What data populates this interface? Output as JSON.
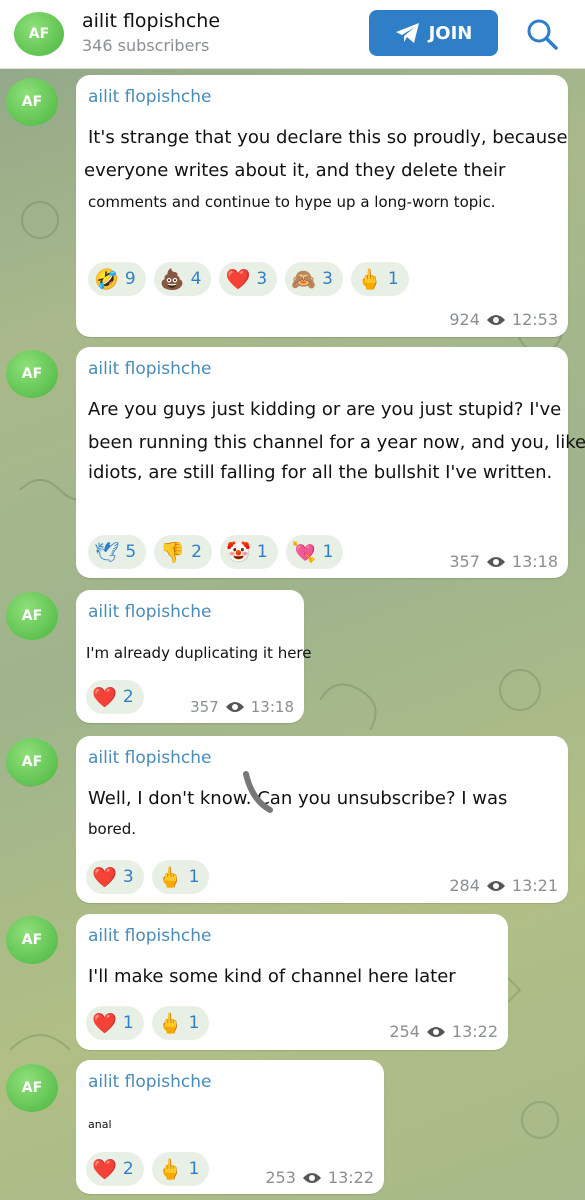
{
  "header": {
    "avatar": "AF",
    "title": "ailit flopishche",
    "subtitle": "346 subscribers",
    "join": "JOIN"
  },
  "messages": [
    {
      "avatar": "AF",
      "author": "ailit flopishche",
      "lines": [
        "It's strange that you declare this so proudly, because",
        "everyone writes about it, and they delete their",
        "comments and continue to hype up a long-worn topic."
      ],
      "reactions": [
        {
          "emoji": "🤣",
          "count": "9"
        },
        {
          "emoji": "💩",
          "count": "4"
        },
        {
          "emoji": "❤️",
          "count": "3"
        },
        {
          "emoji": "🙈",
          "count": "3"
        },
        {
          "emoji": "🖕",
          "count": "1"
        }
      ],
      "views": "924",
      "time": "12:53"
    },
    {
      "avatar": "AF",
      "author": "ailit flopishche",
      "lines": [
        "Are you guys just kidding or are you just stupid? I've",
        "been running this channel for a year now, and you, like",
        "idiots, are still falling for all the bullshit I've written."
      ],
      "reactions": [
        {
          "emoji": "🕊",
          "count": "5"
        },
        {
          "emoji": "👎",
          "count": "2"
        },
        {
          "emoji": "🤡",
          "count": "1"
        },
        {
          "emoji": "💘",
          "count": "1"
        }
      ],
      "views": "357",
      "time": "13:18"
    },
    {
      "avatar": "AF",
      "author": "ailit flopishche",
      "lines": [
        "I'm already duplicating it here"
      ],
      "reactions": [
        {
          "emoji": "❤️",
          "count": "2"
        }
      ],
      "views": "357",
      "time": "13:18"
    },
    {
      "avatar": "AF",
      "author": "ailit flopishche",
      "lines": [
        "Well, I don't know. Can you unsubscribe? I was",
        "bored."
      ],
      "reactions": [
        {
          "emoji": "❤️",
          "count": "3"
        },
        {
          "emoji": "🖕",
          "count": "1"
        }
      ],
      "views": "284",
      "time": "13:21"
    },
    {
      "avatar": "AF",
      "author": "ailit flopishche",
      "lines": [
        "I'll make some kind of channel here later"
      ],
      "reactions": [
        {
          "emoji": "❤️",
          "count": "1"
        },
        {
          "emoji": "🖕",
          "count": "1"
        }
      ],
      "views": "254",
      "time": "13:22"
    },
    {
      "avatar": "AF",
      "author": "ailit flopishche",
      "lines": [
        "anal"
      ],
      "reactions": [
        {
          "emoji": "❤️",
          "count": "2"
        },
        {
          "emoji": "🖕",
          "count": "1"
        }
      ],
      "views": "253",
      "time": "13:22"
    }
  ]
}
